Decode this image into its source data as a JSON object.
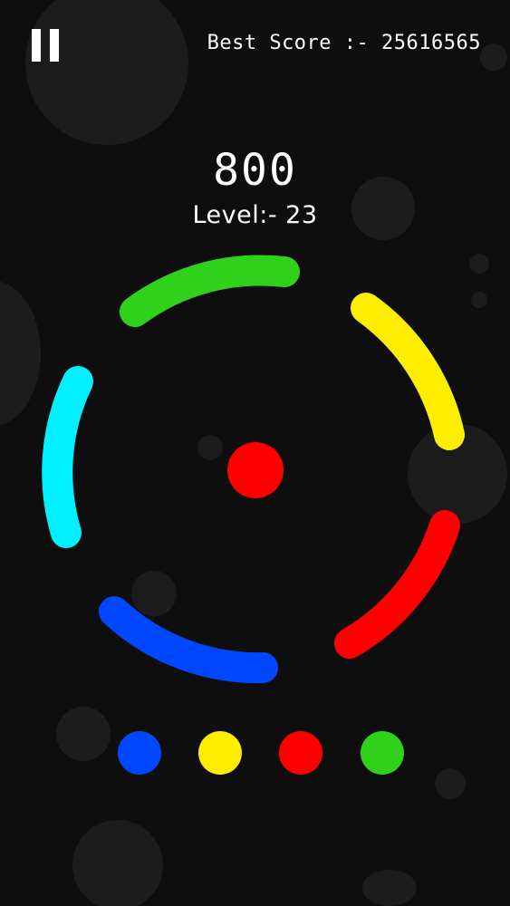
{
  "hud": {
    "best_score_label": "Best Score :- 25616565",
    "score": "800",
    "level_label": "Level:- 23"
  },
  "icons": {
    "pause": "pause-icon"
  },
  "colors": {
    "background": "#0e0e0e",
    "green": "#2fd11a",
    "yellow": "#ffee00",
    "red": "#ff0000",
    "blue": "#0047ff",
    "cyan": "#00f0ff",
    "text": "#ffffff"
  },
  "ring": {
    "segments": [
      {
        "name": "green",
        "color": "#2fd11a"
      },
      {
        "name": "yellow",
        "color": "#ffee00"
      },
      {
        "name": "red",
        "color": "#ff0000"
      },
      {
        "name": "blue",
        "color": "#0047ff"
      },
      {
        "name": "cyan",
        "color": "#00f0ff"
      }
    ]
  },
  "ball": {
    "color": "#ff0000"
  },
  "palette": [
    {
      "name": "blue",
      "color": "#0047ff"
    },
    {
      "name": "yellow",
      "color": "#ffee00"
    },
    {
      "name": "red",
      "color": "#ff0000"
    },
    {
      "name": "green",
      "color": "#2fd11a"
    }
  ]
}
